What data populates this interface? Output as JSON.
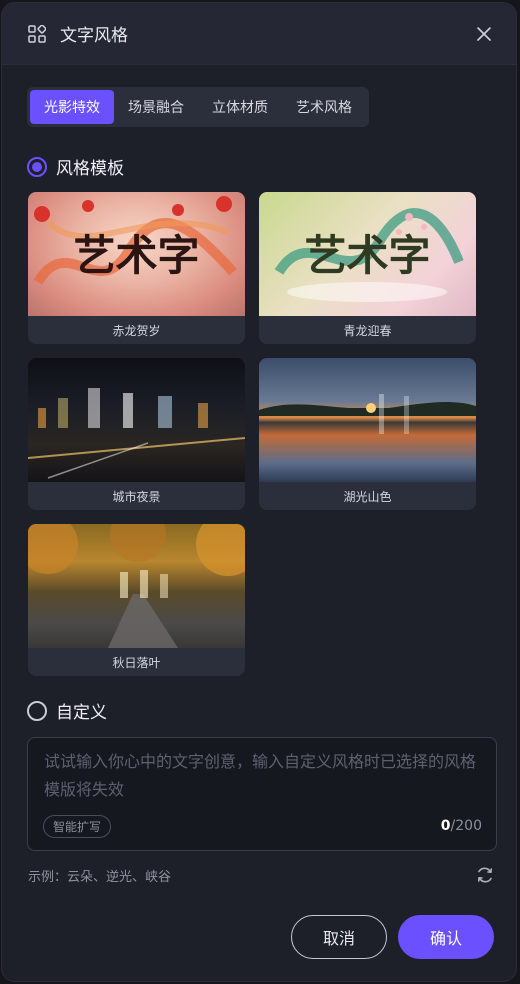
{
  "dialog": {
    "title": "文字风格",
    "icons": {
      "title_icon": "apps-grid-icon",
      "close": "close-icon"
    }
  },
  "tabs": [
    {
      "label": "光影特效",
      "active": true
    },
    {
      "label": "场景融合",
      "active": false
    },
    {
      "label": "立体材质",
      "active": false
    },
    {
      "label": "艺术风格",
      "active": false
    }
  ],
  "style_template": {
    "label": "风格模板",
    "selected": true,
    "cards": [
      {
        "caption": "赤龙贺岁",
        "overlay_text": "艺术字"
      },
      {
        "caption": "青龙迎春",
        "overlay_text": "艺术字"
      },
      {
        "caption": "城市夜景"
      },
      {
        "caption": "湖光山色"
      },
      {
        "caption": "秋日落叶"
      }
    ]
  },
  "custom": {
    "label": "自定义",
    "selected": false,
    "placeholder": "试试输入你心中的文字创意，输入自定义风格时已选择的风格模版将失效",
    "expand_chip": "智能扩写",
    "count_current": "0",
    "count_max": "/200",
    "examples": "示例：云朵、逆光、峡谷"
  },
  "buttons": {
    "cancel": "取消",
    "confirm": "确认"
  },
  "colors": {
    "accent": "#6a50ff",
    "background": "#1d2029",
    "header": "#252834"
  }
}
